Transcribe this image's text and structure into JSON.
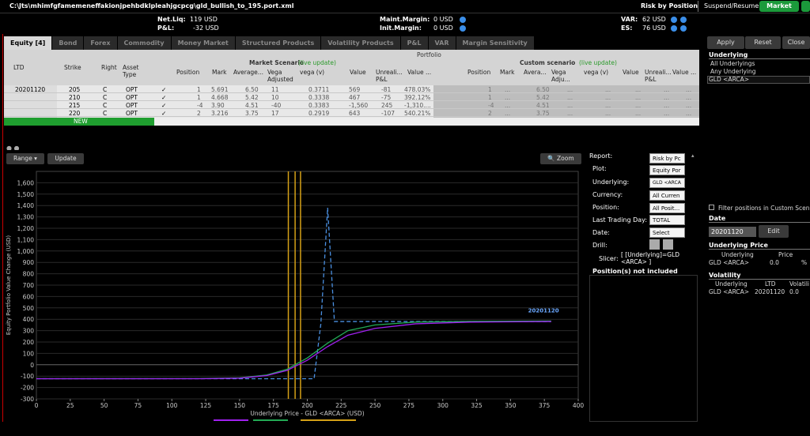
{
  "titlebar": {
    "path": "C:\\Jts\\mhimfgfamemeneffakionjpehbdklpleahjgcpcg\\gld_bullish_to_195.port.xml",
    "risk_by_position": "Risk by Position",
    "suspend_resume": "Suspend/Resume:",
    "market_button": "Market"
  },
  "summary": {
    "net_liq_label": "Net.Liq:",
    "net_liq_value": "119 USD",
    "pnl_label": "P&L:",
    "pnl_value": "-32 USD",
    "maint_margin_label": "Maint.Margin:",
    "maint_margin_value": "0 USD",
    "init_margin_label": "Init.Margin:",
    "init_margin_value": "0 USD",
    "var_label": "VAR:",
    "var_value": "62 USD",
    "es_label": "ES:",
    "es_value": "76 USD"
  },
  "tabs": [
    "Equity [4]",
    "Bond",
    "Forex",
    "Commodity",
    "Money Market",
    "Structured Products",
    "Volatility Products",
    "P&L",
    "VAR",
    "Margin Sensitivity"
  ],
  "grid": {
    "portfolio_label": "Portfolio",
    "market_scenario_label": "Market Scenario",
    "custom_scenario_label": "Custom scenario",
    "live_update": "(live update)",
    "left_headers": [
      "LTD",
      "Strike",
      "Right",
      "Asset Type"
    ],
    "market_headers": [
      "Position",
      "Mark",
      "Average...",
      "Vega Adjusted",
      "vega (v)",
      "Value",
      "Unreali... P&L",
      "Value ..."
    ],
    "custom_headers": [
      "Position",
      "Mark",
      "Avera...",
      "Vega Adju...",
      "vega (v)",
      "Value",
      "Unreali... P&L",
      "Value ..."
    ],
    "ltd": "20201120",
    "rows": [
      {
        "strike": "205",
        "right": "C",
        "type": "OPT",
        "check": "✓",
        "position": "1",
        "mark": "5.691",
        "avg": "6.50",
        "vega_adj": "11",
        "vega": "0.3711",
        "value": "569",
        "upnl": "-81",
        "valpct": "478.03%",
        "c_pos": "1",
        "c_mark": "...",
        "c_avg": "6.50",
        "c_vega_adj": "...",
        "c_vega": "...",
        "c_value": "...",
        "c_upnl": "...",
        "c_valpct": "..."
      },
      {
        "strike": "210",
        "right": "C",
        "type": "OPT",
        "check": "✓",
        "position": "1",
        "mark": "4.668",
        "avg": "5.42",
        "vega_adj": "10",
        "vega": "0.3338",
        "value": "467",
        "upnl": "-75",
        "valpct": "392.12%",
        "c_pos": "1",
        "c_mark": "...",
        "c_avg": "5.42",
        "c_vega_adj": "...",
        "c_vega": "...",
        "c_value": "...",
        "c_upnl": "...",
        "c_valpct": "..."
      },
      {
        "strike": "215",
        "right": "C",
        "type": "OPT",
        "check": "✓",
        "position": "-4",
        "mark": "3.90",
        "avg": "4.51",
        "vega_adj": "-40",
        "vega": "0.3383",
        "value": "-1,560",
        "upnl": "245",
        "valpct": "-1,310....",
        "c_pos": "-4",
        "c_mark": "...",
        "c_avg": "4.51",
        "c_vega_adj": "...",
        "c_vega": "...",
        "c_value": "...",
        "c_upnl": "...",
        "c_valpct": "..."
      },
      {
        "strike": "220",
        "right": "C",
        "type": "OPT",
        "check": "✓",
        "position": "2",
        "mark": "3.216",
        "avg": "3.75",
        "vega_adj": "17",
        "vega": "0.2919",
        "value": "643",
        "upnl": "-107",
        "valpct": "540.21%",
        "c_pos": "2",
        "c_mark": "...",
        "c_avg": "3.75",
        "c_vega_adj": "...",
        "c_vega": "...",
        "c_value": "...",
        "c_upnl": "...",
        "c_valpct": "..."
      }
    ],
    "new_label": "NEW"
  },
  "chart_controls": {
    "range": "Range ▾",
    "update": "Update",
    "zoom": "Zoom"
  },
  "form": {
    "report_label": "Report:",
    "report_value": "Risk by Pc",
    "plot_label": "Plot:",
    "plot_value": "Equity Por",
    "underlying_label": "Underlying:",
    "underlying_value": "GLD <ARCA",
    "currency_label": "Currency:",
    "currency_value": "All Curren",
    "position_label": "Position:",
    "position_value": "All Posit...",
    "ltd_label": "Last Trading Day:",
    "ltd_value": "TOTAL",
    "date_label": "Date:",
    "date_value": "Select",
    "drill_label": "Drill:",
    "slicer_label": "Slicer:",
    "slicer_value": "[ [Underlying]=GLD <ARCA> ]",
    "not_included": "Position(s) not included"
  },
  "side": {
    "apply": "Apply",
    "reset": "Reset",
    "close": "Close",
    "underlying_hdr": "Underlying",
    "underlying_items": [
      "All Underlyings",
      "Any Underlying",
      "GLD <ARCA>"
    ],
    "filter_label": "Filter positions in Custom Scen",
    "date_hdr": "Date",
    "date_value": "20201120",
    "edit": "Edit",
    "uprice_hdr": "Underlying Price",
    "uprice_cols": [
      "Underlying",
      "Price"
    ],
    "uprice_row": [
      "GLD <ARCA>",
      "0.0",
      "%"
    ],
    "vol_hdr": "Volatility",
    "vol_cols": [
      "Underlying",
      "LTD",
      "Volatili"
    ],
    "vol_row": [
      "GLD <ARCA>",
      "20201120",
      "0.0"
    ]
  },
  "chart_data": {
    "type": "line",
    "ylabel": "Equity Portfolio Value Change (USD)",
    "xlabel": "Underlying Price - GLD <ARCA> (USD)",
    "xlim": [
      0,
      400
    ],
    "ylim": [
      -300,
      1700
    ],
    "xticks": [
      0,
      25,
      50,
      75,
      100,
      125,
      150,
      175,
      200,
      225,
      250,
      275,
      300,
      325,
      350,
      375,
      400
    ],
    "yticks": [
      -300,
      -200,
      -100,
      0,
      100,
      200,
      300,
      400,
      500,
      600,
      700,
      800,
      900,
      1000,
      1100,
      1200,
      1300,
      1400,
      1500,
      1600
    ],
    "annotation": "20201120",
    "vlines": [
      186,
      191,
      195
    ],
    "series": [
      {
        "style": "dashed",
        "color": "#4a8fe0",
        "x": [
          0,
          150,
          205,
          210,
          215,
          220,
          225,
          380
        ],
        "y": [
          -123,
          -123,
          -123,
          360,
          1380,
          380,
          380,
          380
        ]
      },
      {
        "style": "solid",
        "color": "#22aa55",
        "x": [
          0,
          120,
          150,
          170,
          185,
          200,
          215,
          230,
          250,
          280,
          320,
          380
        ],
        "y": [
          -123,
          -122,
          -115,
          -90,
          -40,
          60,
          190,
          300,
          350,
          375,
          382,
          385
        ]
      },
      {
        "style": "solid",
        "color": "#a020f0",
        "x": [
          0,
          120,
          150,
          170,
          185,
          200,
          215,
          230,
          250,
          280,
          320,
          380
        ],
        "y": [
          -123,
          -123,
          -118,
          -95,
          -50,
          40,
          160,
          260,
          320,
          360,
          375,
          380
        ]
      }
    ]
  }
}
